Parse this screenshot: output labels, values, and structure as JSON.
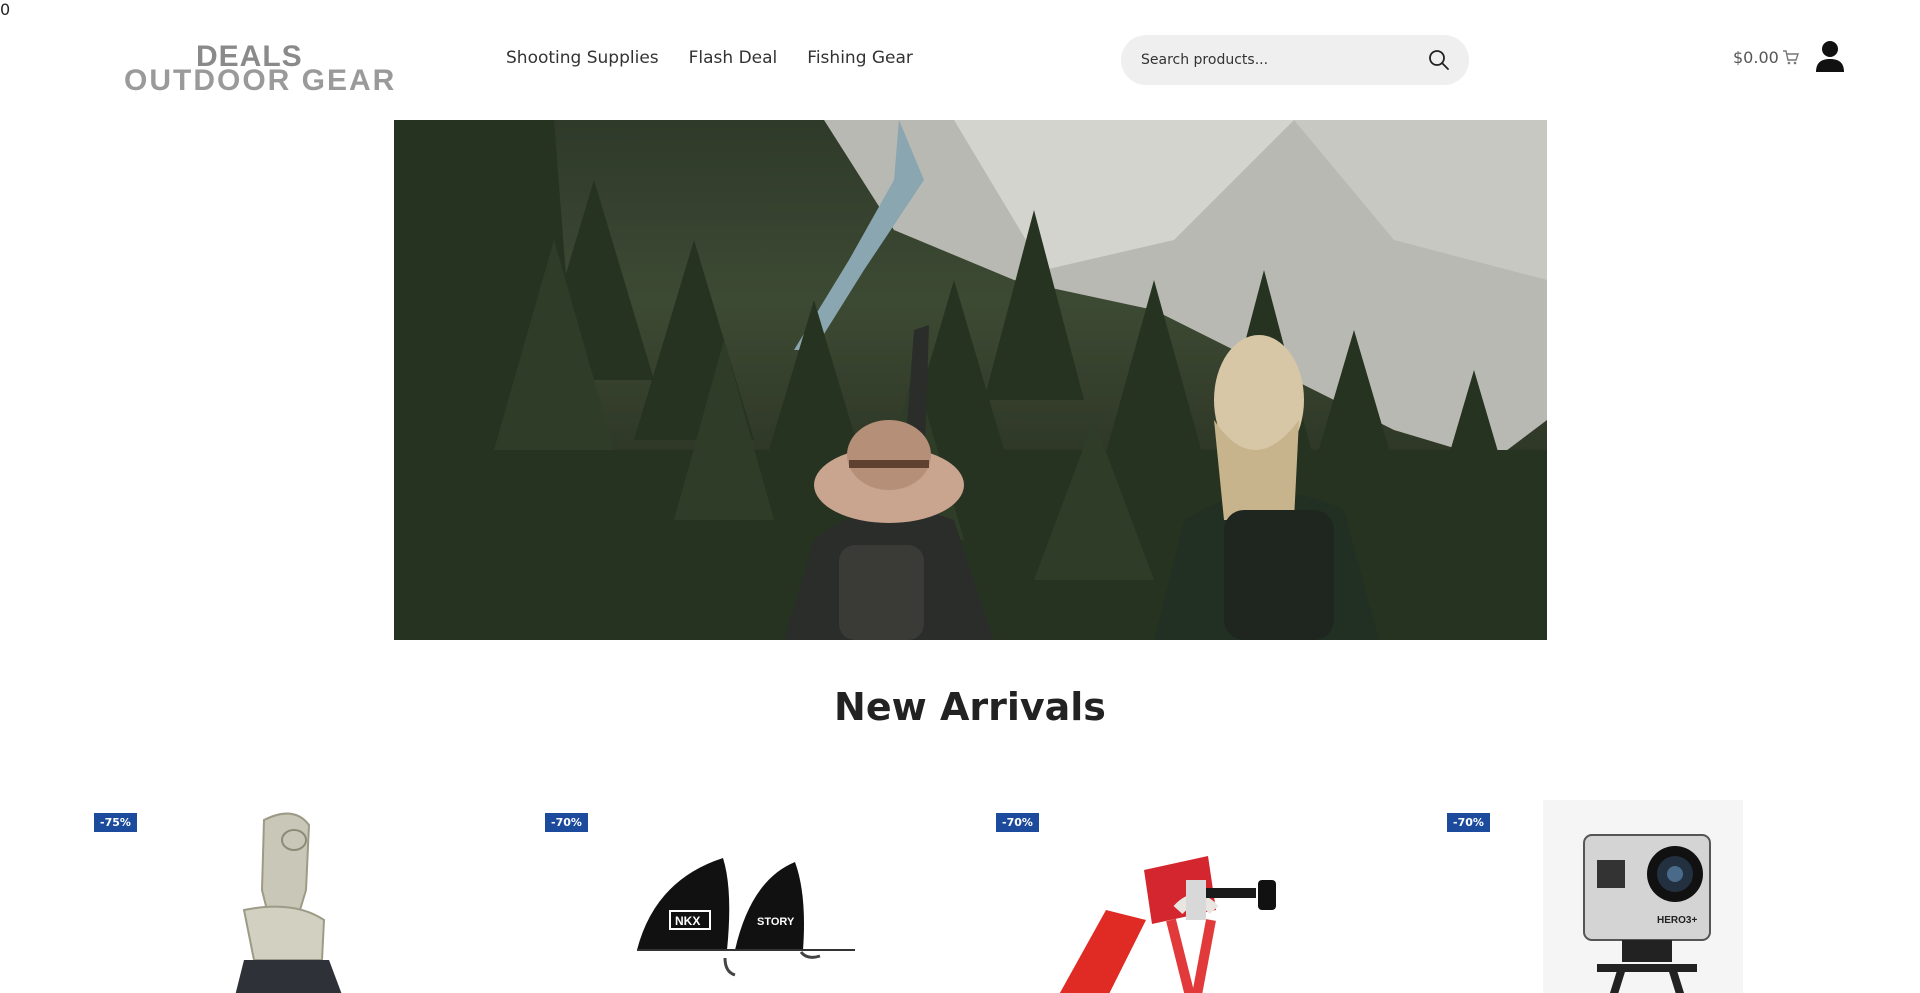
{
  "header": {
    "logo_top": "DEALS",
    "logo_bottom": "OUTDOOR GEAR",
    "nav": [
      "Shooting Supplies",
      "Flash Deal",
      "Fishing Gear"
    ],
    "search_placeholder": "Search products...",
    "cart_amount": "$0.00",
    "cart_count": "0"
  },
  "main": {
    "section_title": "New Arrivals",
    "products": [
      {
        "discount": "-75%",
        "icon": "snowboard-binding"
      },
      {
        "discount": "-70%",
        "icon": "paddleboard-fins"
      },
      {
        "discount": "-70%",
        "icon": "camera-mount-kit"
      },
      {
        "discount": "-70%",
        "icon": "action-camera"
      }
    ]
  }
}
